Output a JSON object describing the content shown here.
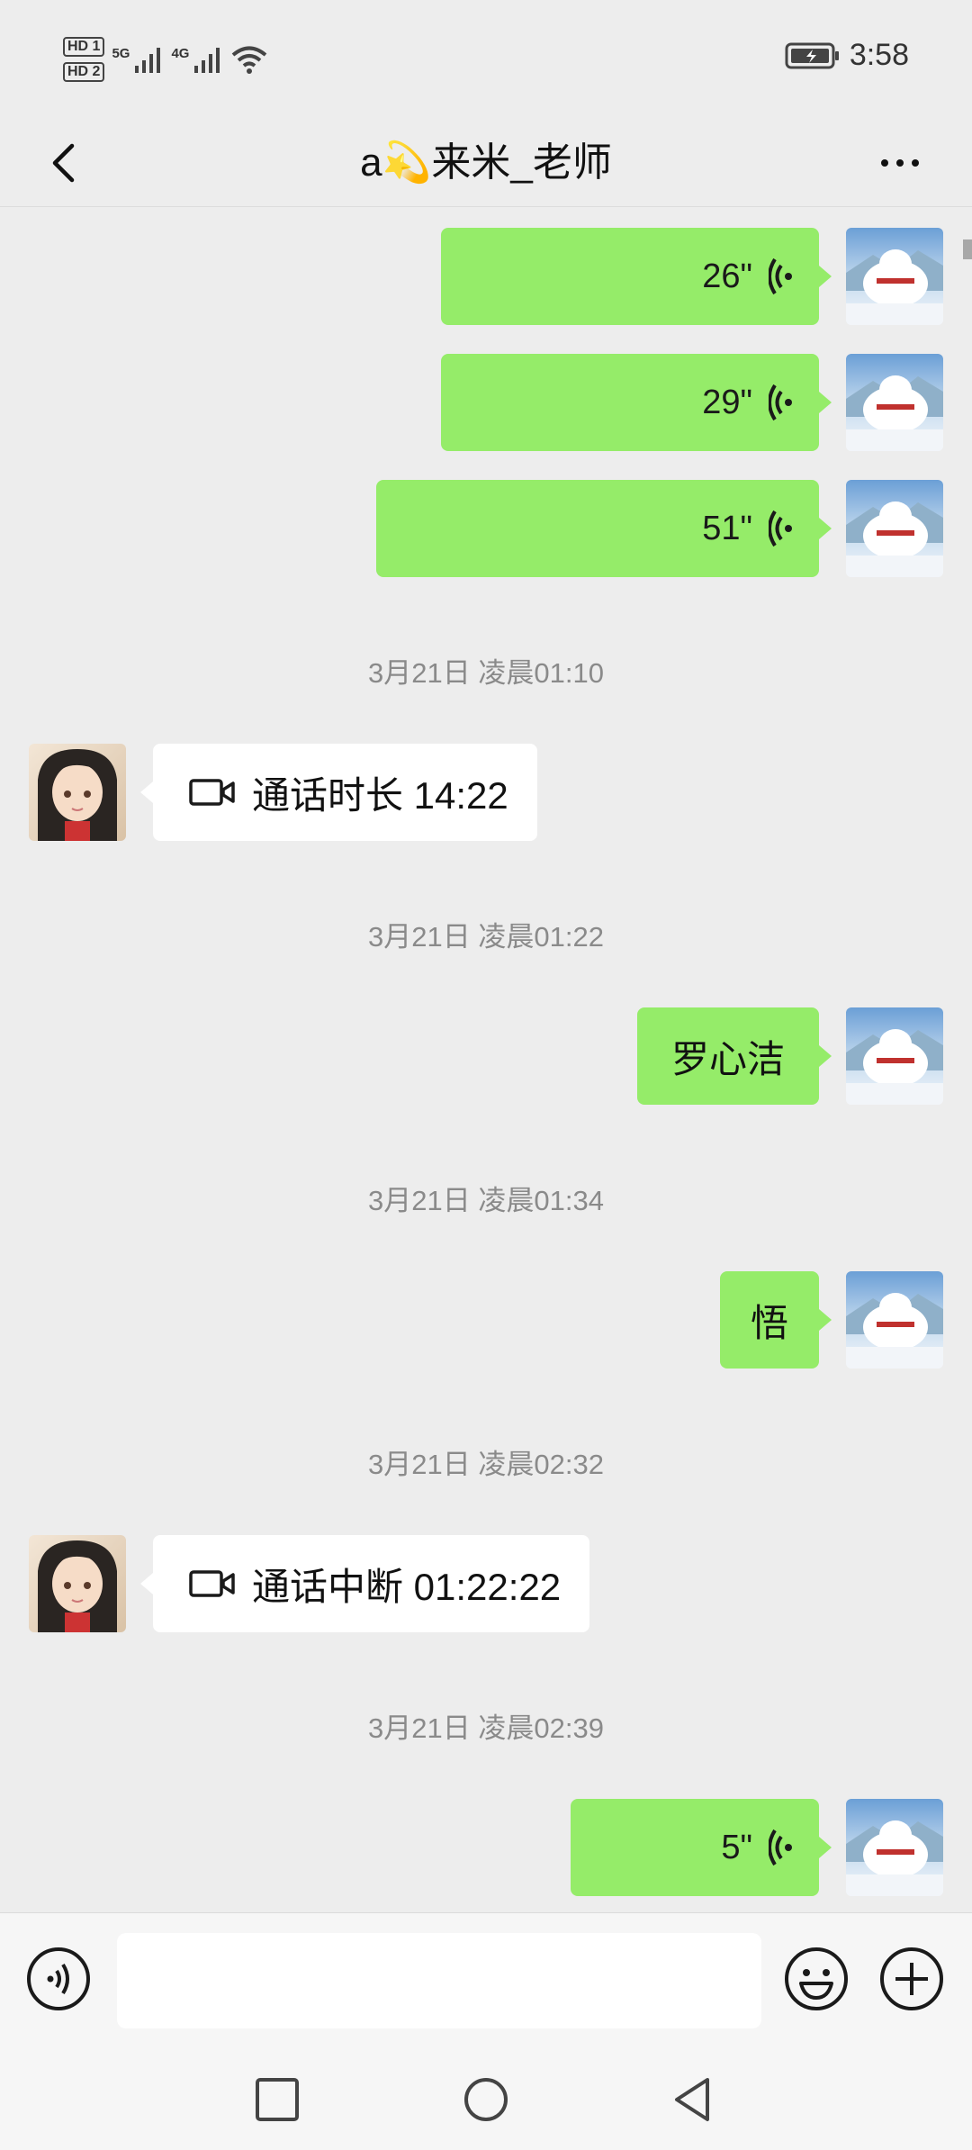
{
  "status_bar": {
    "hd1": "HD 1",
    "hd2": "HD 2",
    "network1": "5G",
    "network2": "4G",
    "time": "3:58"
  },
  "header": {
    "title": "a💫来米_老师"
  },
  "messages": [
    {
      "type": "voice",
      "sender": "self",
      "duration": "26\""
    },
    {
      "type": "voice",
      "sender": "self",
      "duration": "29\""
    },
    {
      "type": "voice",
      "sender": "self",
      "duration": "51\""
    },
    {
      "type": "timestamp",
      "text": "3月21日 凌晨01:10"
    },
    {
      "type": "video_call",
      "sender": "other",
      "text": "通话时长 14:22"
    },
    {
      "type": "timestamp",
      "text": "3月21日 凌晨01:22"
    },
    {
      "type": "text",
      "sender": "self",
      "text": "罗心洁"
    },
    {
      "type": "timestamp",
      "text": "3月21日 凌晨01:34"
    },
    {
      "type": "text",
      "sender": "self",
      "text": "悟"
    },
    {
      "type": "timestamp",
      "text": "3月21日 凌晨02:32"
    },
    {
      "type": "video_call",
      "sender": "other",
      "text": "通话中断 01:22:22"
    },
    {
      "type": "timestamp",
      "text": "3月21日 凌晨02:39"
    },
    {
      "type": "voice",
      "sender": "self",
      "duration": "5\""
    }
  ],
  "input_bar": {
    "placeholder": ""
  },
  "colors": {
    "self_bubble": "#95ec69",
    "other_bubble": "#ffffff",
    "background": "#ededed"
  }
}
